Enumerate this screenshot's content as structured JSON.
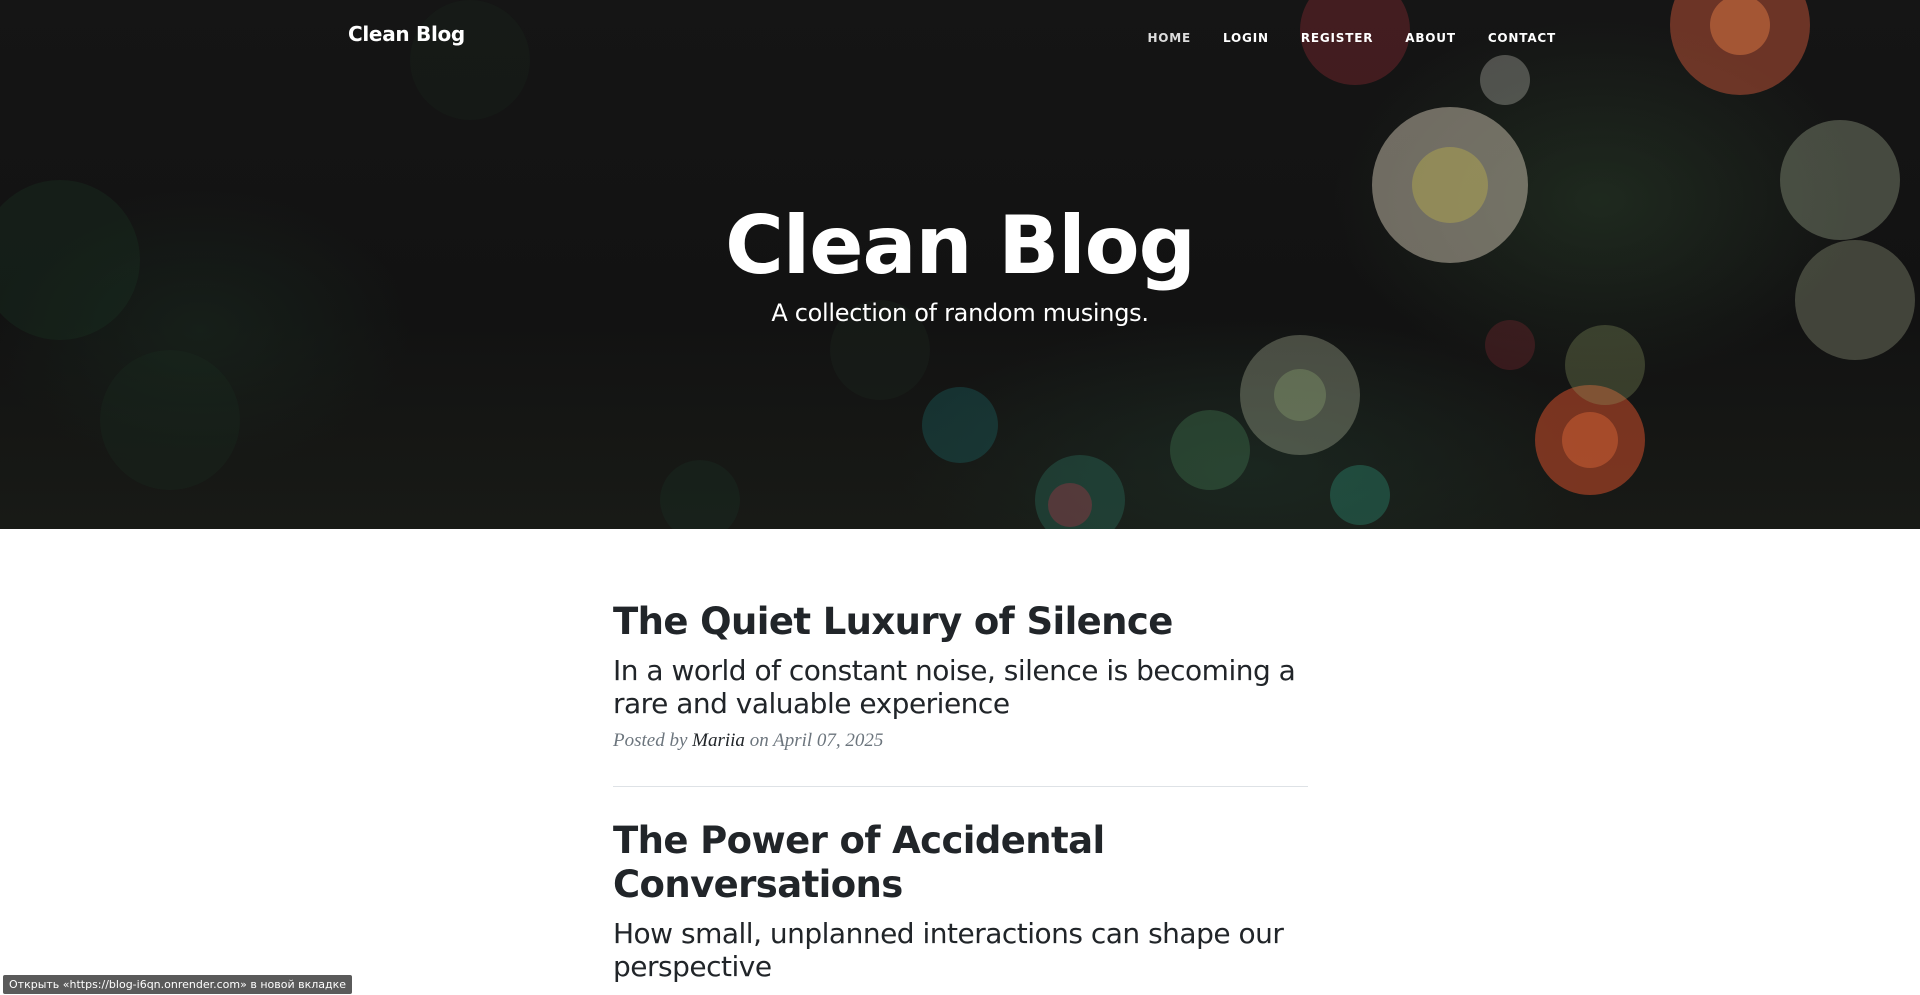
{
  "navbar": {
    "brand": "Clean Blog",
    "links": [
      {
        "label": "HOME"
      },
      {
        "label": "LOGIN"
      },
      {
        "label": "REGISTER"
      },
      {
        "label": "ABOUT"
      },
      {
        "label": "CONTACT"
      }
    ]
  },
  "hero": {
    "title": "Clean Blog",
    "subtitle": "A collection of random musings."
  },
  "posts": [
    {
      "title": "The Quiet Luxury of Silence",
      "subtitle": "In a world of constant noise, silence is becoming a rare and valuable experience",
      "meta_prefix": "Posted by",
      "author": "Mariia",
      "meta_on": "on",
      "date": "April 07, 2025"
    },
    {
      "title": "The Power of Accidental Conversations",
      "subtitle": "How small, unplanned interactions can shape our perspective"
    }
  ],
  "status_bar": {
    "text": "Открыть «https://blog-i6qn.onrender.com» в новой вкладке"
  },
  "colors": {
    "hero_bg": "#151515",
    "text": "#212529",
    "meta": "#6c757d",
    "divider": "#dee2e6"
  }
}
